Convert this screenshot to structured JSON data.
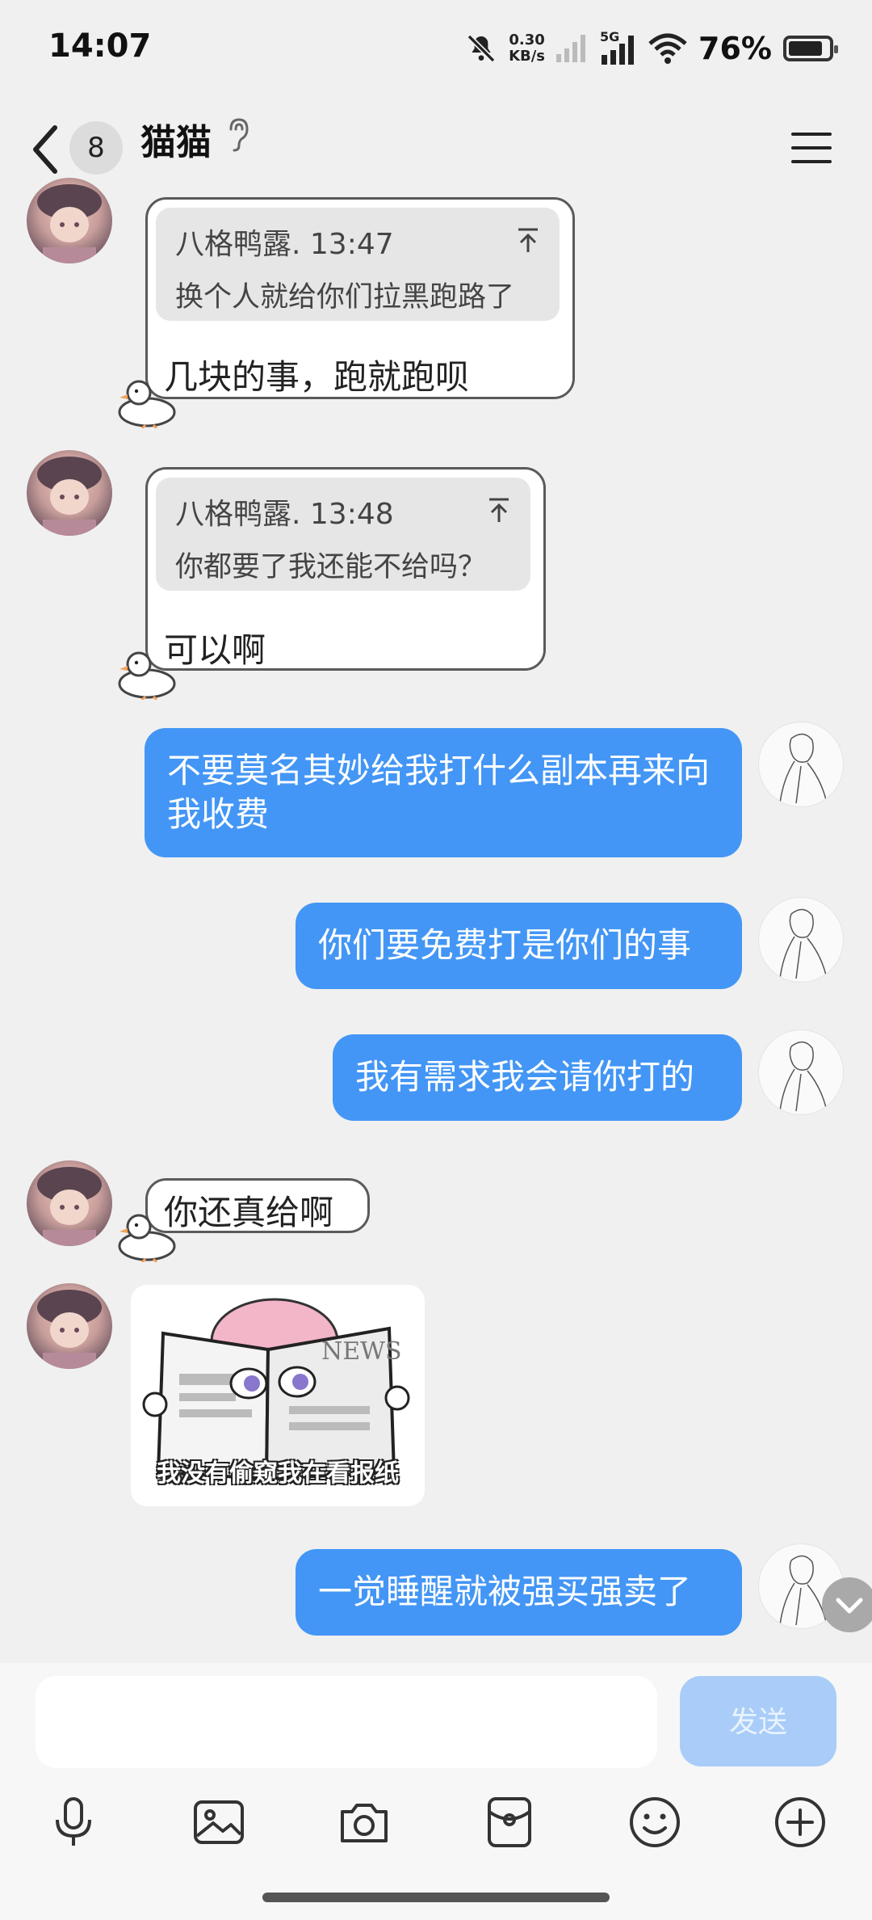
{
  "status_bar": {
    "time": "14:07",
    "net_speed_value": "0.30",
    "net_speed_unit": "KB/s",
    "network": "5G",
    "battery": "76%"
  },
  "header": {
    "unread_count": "8",
    "title": "猫猫"
  },
  "messages": [
    {
      "side": "left",
      "quote_author_time": "八格鸭露. 13:47",
      "quote_text": "换个人就给你们拉黑跑路了",
      "text": "几块的事，跑就跑呗"
    },
    {
      "side": "left",
      "quote_author_time": "八格鸭露. 13:48",
      "quote_text": "你都要了我还能不给吗？",
      "text": "可以啊"
    },
    {
      "side": "right",
      "text": "不要莫名其妙给我打什么副本再来向我收费"
    },
    {
      "side": "right",
      "text": "你们要免费打是你们的事"
    },
    {
      "side": "right",
      "text": "我有需求我会请你打的"
    },
    {
      "side": "left",
      "text": "你还真给啊"
    },
    {
      "side": "left",
      "type": "sticker",
      "sticker_caption": "我没有偷窥我在看报纸",
      "sticker_sign": "NEWS"
    },
    {
      "side": "right",
      "text": "一觉睡醒就被强买强卖了"
    }
  ],
  "input": {
    "placeholder": "",
    "send_label": "发送"
  },
  "toolbar_icons": [
    "microphone-icon",
    "image-icon",
    "camera-icon",
    "red-packet-icon",
    "emoji-icon",
    "plus-icon"
  ],
  "colors": {
    "outgoing_bubble": "#4396f5",
    "send_button_disabled": "#a9cdf8",
    "background": "#f0f0f0"
  }
}
